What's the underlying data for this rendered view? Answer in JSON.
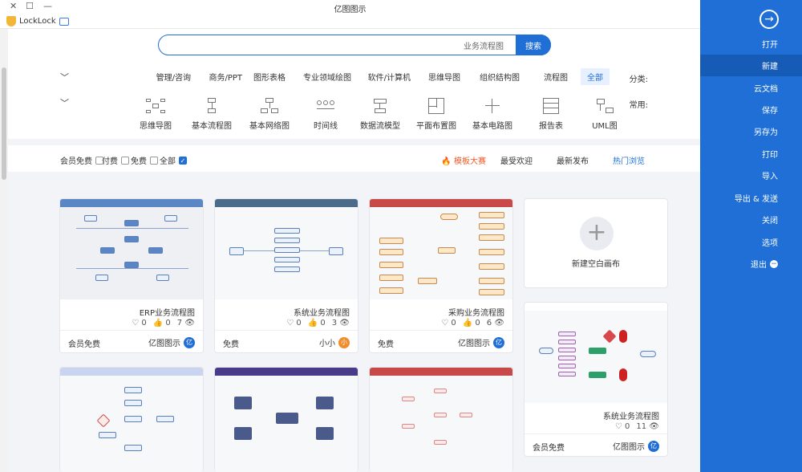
{
  "window": {
    "title": "亿图图示",
    "tab_label": "LockLock"
  },
  "sidebar": {
    "items": [
      {
        "label": "打开"
      },
      {
        "label": "新建"
      },
      {
        "label": "云文档"
      },
      {
        "label": "保存"
      },
      {
        "label": "另存为"
      },
      {
        "label": "打印"
      },
      {
        "label": "导入"
      },
      {
        "label": "导出 & 发送"
      },
      {
        "label": "关闭"
      },
      {
        "label": "选项"
      },
      {
        "label": "退出"
      }
    ]
  },
  "search": {
    "button_label": "搜索",
    "value": "业务流程图"
  },
  "categories": {
    "label": "分类:",
    "items": [
      "全部",
      "流程图",
      "组织结构图",
      "思维导图",
      "软件/计算机",
      "专业领域绘图",
      "图形表格",
      "商务/PPT",
      "管理/咨询"
    ]
  },
  "common": {
    "label": "常用:",
    "items": [
      "UML图",
      "报告表",
      "基本电路图",
      "平面布置图",
      "数据流模型",
      "时间线",
      "基本网络图",
      "基本流程图",
      "思维导图"
    ]
  },
  "sort": {
    "items": [
      "热门浏览",
      "最新发布",
      "最受欢迎",
      "模板大赛"
    ],
    "filters": [
      "全部",
      "免费",
      "付费",
      "会员免费"
    ]
  },
  "new_card": {
    "label": "新建空白画布"
  },
  "cards": [
    {
      "name": "采购业务流程图",
      "views": "6",
      "likes": "0",
      "comments": "0",
      "price": "免费",
      "author": "亿图图示",
      "color": "#c94848"
    },
    {
      "name": "系统业务流程图",
      "views": "3",
      "likes": "0",
      "comments": "0",
      "price": "免费",
      "author": "小小",
      "color": "#4b6b8a"
    },
    {
      "name": "ERP业务流程图",
      "views": "7",
      "likes": "0",
      "comments": "0",
      "price": "会员免费",
      "author": "亿图图示",
      "color": "#5a86c5"
    },
    {
      "name": "系统业务流程图",
      "views": "11",
      "likes": "0",
      "comments": "0",
      "price": "会员免费",
      "author": "亿图图示",
      "color": "#5a86c5"
    }
  ],
  "colors": {
    "accent": "#1f6fd6",
    "hot": "#f05a28"
  }
}
